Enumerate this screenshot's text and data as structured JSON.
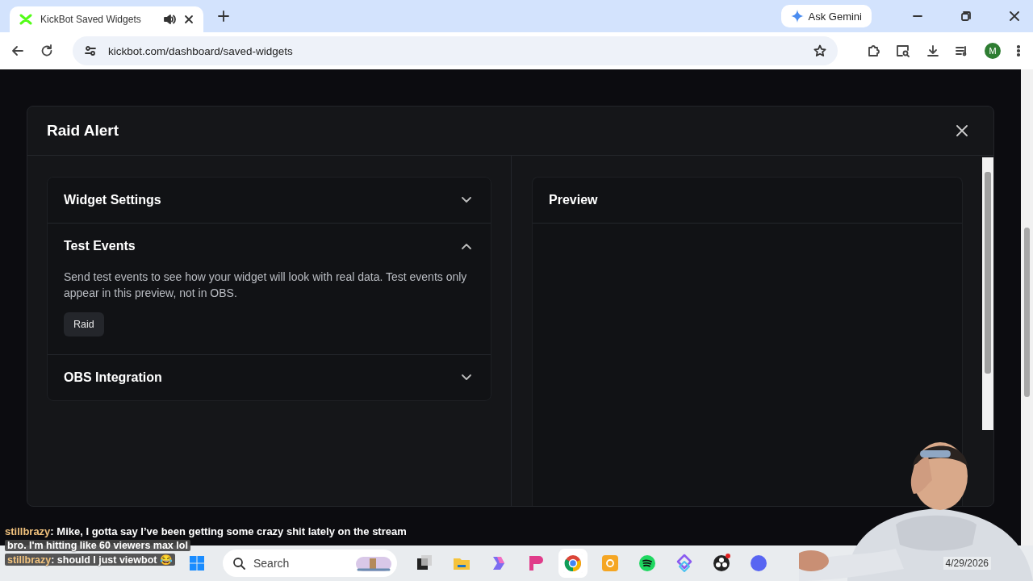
{
  "browser": {
    "tab": {
      "title": "KickBot Saved Widgets"
    },
    "url": "kickbot.com/dashboard/saved-widgets",
    "gemini": "Ask Gemini",
    "profile": "M"
  },
  "modal": {
    "title": "Raid Alert",
    "sections": [
      {
        "title": "Widget Settings",
        "expanded": false
      },
      {
        "title": "Test Events",
        "expanded": true,
        "description": "Send test events to see how your widget will look with real data. Test events only appear in this preview, not in OBS.",
        "buttons": [
          "Raid"
        ]
      },
      {
        "title": "OBS Integration",
        "expanded": false
      }
    ],
    "preview": {
      "title": "Preview"
    }
  },
  "chat": [
    {
      "user": "stillbrazy",
      "message": ": Mike, I gotta say I’ve been getting some crazy shit lately on the stream"
    },
    {
      "message": "bro. I'm hitting like 60 viewers max lol"
    },
    {
      "user": "stillbrazy",
      "message": ": should I just viewbot 😂"
    }
  ],
  "taskbar": {
    "search": "Search",
    "date": "4/29/2026"
  }
}
